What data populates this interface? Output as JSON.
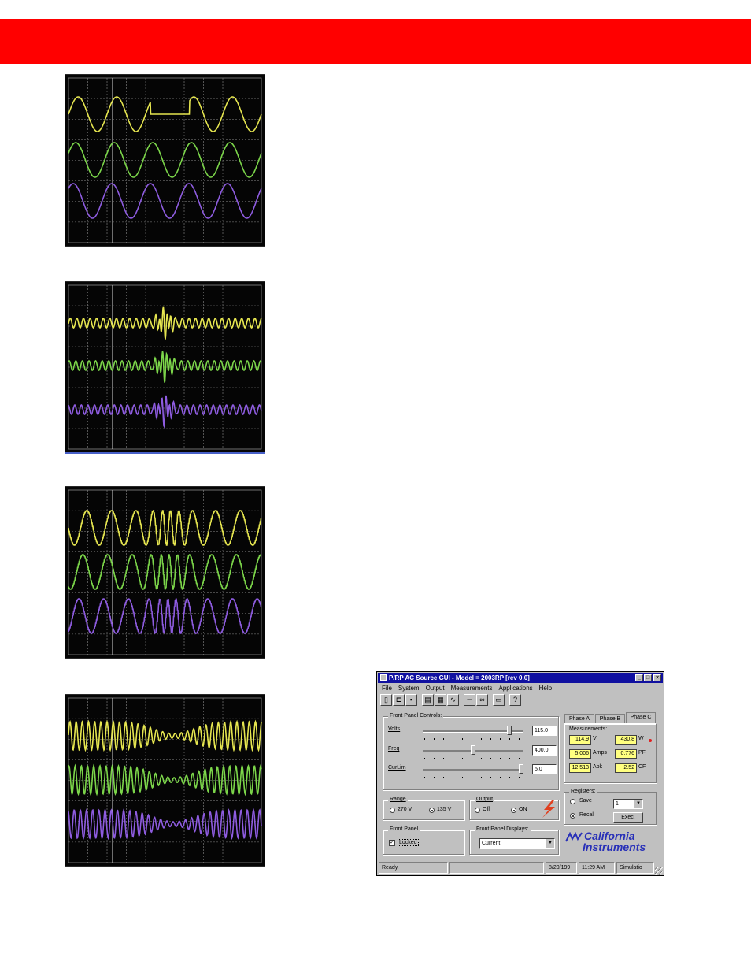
{
  "colors": {
    "banner": "#ff0000",
    "trace_yellow": "#e6e650",
    "trace_green": "#7cd64a",
    "trace_purple": "#8e5ce0",
    "grid": "#8a8a8a"
  },
  "scopes": [
    {
      "name": "dropout",
      "traces": [
        "yellow",
        "green",
        "purple"
      ]
    },
    {
      "name": "transient",
      "traces": [
        "yellow",
        "green",
        "purple"
      ]
    },
    {
      "name": "frequency-sweep",
      "traces": [
        "yellow",
        "green",
        "purple"
      ]
    },
    {
      "name": "amplitude-sag",
      "traces": [
        "yellow",
        "green",
        "purple"
      ]
    }
  ],
  "gui": {
    "title": "P/RP AC Source GUI - Model = 2003RP [rev 0.0]",
    "title_buttons": [
      "_",
      "□",
      "×"
    ],
    "menu": [
      "File",
      "System",
      "Output",
      "Measurements",
      "Applications",
      "Help"
    ],
    "toolbar_icons": [
      "new-icon",
      "open-icon",
      "save-icon",
      "chart-icon",
      "grid-icon",
      "wave-icon",
      "transient-icon",
      "binoculars-icon",
      "monitor-icon",
      "help-icon"
    ],
    "front_panel": {
      "title": "Front Panel Controls:",
      "volts_label": "Volts",
      "volts_value": "115.0",
      "volts_level": 0.88,
      "freq_label": "Freq",
      "freq_value": "400.0",
      "freq_level": 0.5,
      "curlim_label": "CurLim",
      "curlim_value": "5.0",
      "curlim_level": 1.0
    },
    "tabs": [
      "Phase A",
      "Phase B",
      "Phase C"
    ],
    "measurements": {
      "title": "Measurements:",
      "rows": [
        {
          "v1": "114.9",
          "u1": "V",
          "v2": "430.8",
          "u2": "W"
        },
        {
          "v1": "5.006",
          "u1": "Amps",
          "v2": "0.776",
          "u2": "PF"
        },
        {
          "v1": "12.513",
          "u1": "Apk",
          "v2": "2.52",
          "u2": "CF"
        }
      ]
    },
    "range": {
      "title": "Range",
      "options": [
        "270 V",
        "135 V"
      ],
      "selected": "135 V"
    },
    "output": {
      "title": "Output",
      "options": [
        "Off",
        "ON"
      ],
      "selected": "ON"
    },
    "registers": {
      "title": "Registers:",
      "save": "Save",
      "recall": "Recall",
      "selected": "Recall",
      "number": "1",
      "exec": "Exec."
    },
    "front_panel_lock": {
      "title": "Front Panel",
      "locked_label": "Locked",
      "checked": true
    },
    "front_panel_displays": {
      "title": "Front Panel Displays:",
      "value": "Current"
    },
    "logo": {
      "line1": "California",
      "line2": "Instruments"
    },
    "status": [
      "Ready.",
      "",
      "8/20/199",
      "11:29 AM",
      "Simulatio"
    ]
  }
}
